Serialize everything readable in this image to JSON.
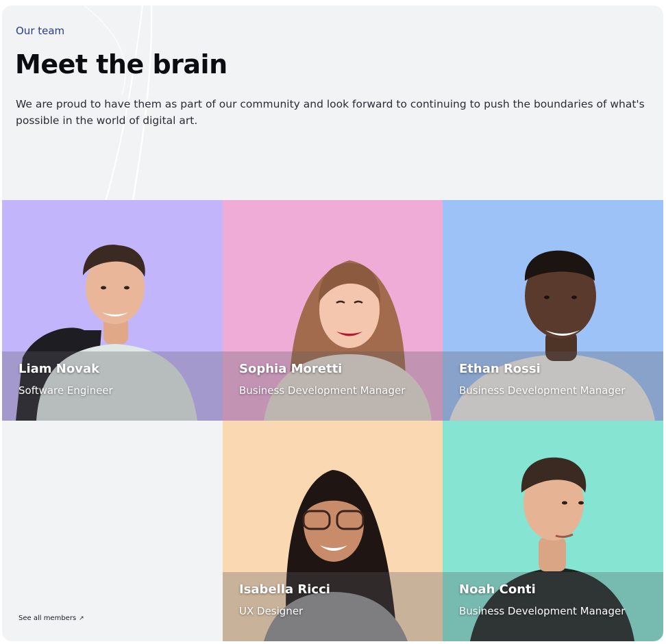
{
  "header": {
    "eyebrow": "Our team",
    "title": "Meet the brain",
    "description": "We are proud to have them as part of our community and look forward to continuing to push the boundaries of what's possible in the world of digital art."
  },
  "members": [
    {
      "name": "Liam Novak",
      "role": "Software Engineer",
      "bg": "#c3b5fb"
    },
    {
      "name": "Sophia Moretti",
      "role": "Business Development Manager",
      "bg": "#efacd6"
    },
    {
      "name": "Ethan Rossi",
      "role": "Business Development Manager",
      "bg": "#9cc2f7"
    },
    {
      "name": "Isabella Ricci",
      "role": "UX Designer",
      "bg": "#f9d8b2"
    },
    {
      "name": "Noah Conti",
      "role": "Business Development Manager",
      "bg": "#85e4d2"
    }
  ],
  "footer": {
    "see_all_label": "See all members",
    "see_all_icon": "arrow-up-right-icon"
  }
}
